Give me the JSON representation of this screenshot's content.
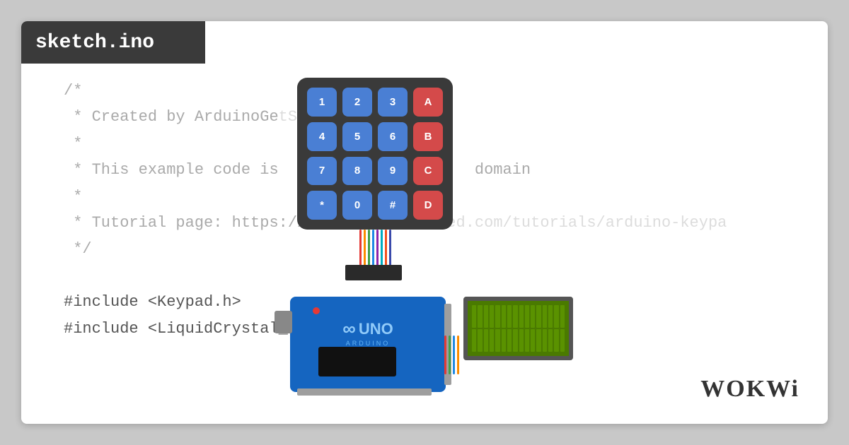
{
  "header": {
    "title": "sketch.ino"
  },
  "code": {
    "lines": [
      "/*",
      " * Created by ArduinoGetStarted.com",
      " *",
      " * This example code is                    domain",
      " *",
      " * Tutorial page: https://arduinogetstarted.com/tutorials/arduino-keypa",
      " */"
    ],
    "includes": [
      "#include <Keypad.h>",
      "#include <LiquidCrystal_I2C.h>"
    ]
  },
  "keypad": {
    "keys": [
      {
        "label": "1",
        "color": "blue"
      },
      {
        "label": "2",
        "color": "blue"
      },
      {
        "label": "3",
        "color": "blue"
      },
      {
        "label": "A",
        "color": "red"
      },
      {
        "label": "4",
        "color": "blue"
      },
      {
        "label": "5",
        "color": "blue"
      },
      {
        "label": "6",
        "color": "blue"
      },
      {
        "label": "B",
        "color": "red"
      },
      {
        "label": "7",
        "color": "blue"
      },
      {
        "label": "8",
        "color": "blue"
      },
      {
        "label": "9",
        "color": "blue"
      },
      {
        "label": "C",
        "color": "red"
      },
      {
        "label": "*",
        "color": "blue"
      },
      {
        "label": "0",
        "color": "blue"
      },
      {
        "label": "#",
        "color": "blue"
      },
      {
        "label": "D",
        "color": "red"
      }
    ]
  },
  "arduino": {
    "model": "UNO",
    "brand": "ARDUINO"
  },
  "wokwi": {
    "logo": "WOKWi"
  },
  "wire_colors": [
    "#e53935",
    "#43a047",
    "#1e88e5",
    "#fb8c00",
    "#8e24aa",
    "#00acc1",
    "#f4511e",
    "#3949ab"
  ]
}
